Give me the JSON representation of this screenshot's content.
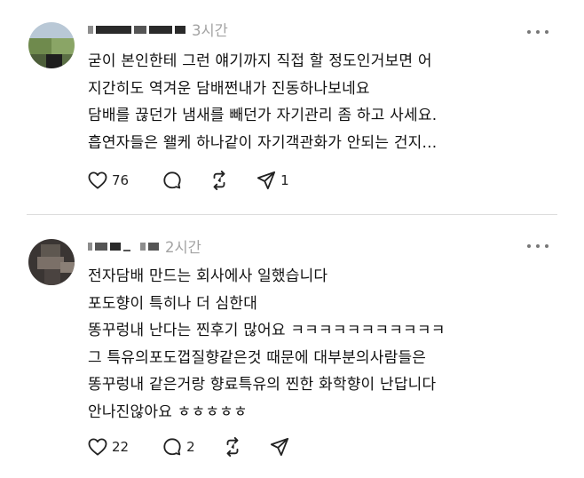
{
  "posts": [
    {
      "time": "3시간",
      "lines": [
        "굳이 본인한테 그런 얘기까지 직접 할 정도인거보면 어",
        "지간히도 역겨운 담배쩐내가 진동하나보네요",
        "담배를 끊던가 냄새를 빼던가 자기관리 좀 하고 사세요.",
        "흡연자들은 왤케 하나같이 자기객관화가 안되는 건지..."
      ],
      "likes": "76",
      "comments": "",
      "reposts": "",
      "shares": "1"
    },
    {
      "time": "2시간",
      "lines": [
        "전자담배 만드는 회사에사 일했습니다",
        "포도향이 특히나 더 심한대",
        "똥꾸렁내 난다는 찐후기 많어요 ㅋㅋㅋㅋㅋㅋㅋㅋㅋㅋㅋ",
        "그 특유의포도껍질향같은것 때문에 대부분의사람들은",
        "똥꾸렁내 같은거랑 향료특유의 찐한 화학향이 난답니다",
        "안나진않아요 ㅎㅎㅎㅎㅎ"
      ],
      "likes": "22",
      "comments": "2",
      "reposts": "",
      "shares": ""
    }
  ],
  "icons": {
    "like": "heart-icon",
    "comment": "comment-icon",
    "repost": "repost-icon",
    "share": "share-icon",
    "more": "more-icon"
  }
}
